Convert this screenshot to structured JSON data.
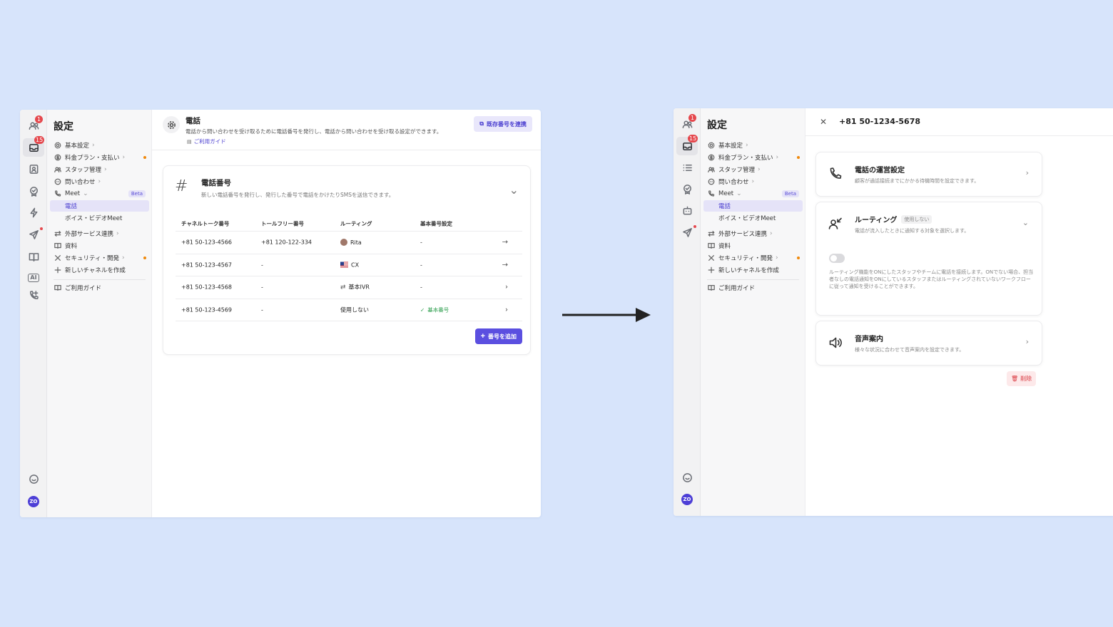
{
  "left_window": {
    "rail": {
      "team_badge": "1",
      "inbox_badge": "15",
      "avatar_text": "ZO",
      "ai_label": "AI"
    },
    "sidebar": {
      "title": "設定",
      "items": [
        {
          "label": "基本設定",
          "icon": "gear-icon"
        },
        {
          "label": "料金プラン・支払い",
          "icon": "dollar-icon"
        },
        {
          "label": "スタッフ管理",
          "icon": "users-icon"
        },
        {
          "label": "問い合わせ",
          "icon": "chat-icon"
        },
        {
          "label": "Meet",
          "icon": "phone-icon",
          "badge": "Beta"
        },
        {
          "label": "電話"
        },
        {
          "label": "ボイス・ビデオMeet"
        },
        {
          "label": "外部サービス連携",
          "icon": "swap-icon"
        },
        {
          "label": "資料",
          "icon": "book-icon"
        },
        {
          "label": "セキュリティ・開発",
          "icon": "tools-icon"
        },
        {
          "label": "新しいチャネルを作成",
          "icon": "plus-icon"
        },
        {
          "label": "ご利用ガイド",
          "icon": "book-icon"
        }
      ]
    },
    "header": {
      "title": "電話",
      "description": "電話から問い合わせを受け取るために電話番号を発行し、電話から問い合わせを受け取る設定ができます。",
      "guide_link": "ご利用ガイド",
      "link_existing_button": "既存番号を連携"
    },
    "card": {
      "title": "電話番号",
      "subtitle": "新しい電話番号を発行し、発行した番号で電話をかけたりSMSを送信できます。",
      "columns": [
        "チャネルトーク番号",
        "トールフリー番号",
        "ルーティング",
        "基本番号設定"
      ],
      "rows": [
        {
          "number": "+81 50-123-4566",
          "tollfree": "+81 120-122-334",
          "routing": "Rita",
          "default": "-"
        },
        {
          "number": "+81 50-123-4567",
          "tollfree": "-",
          "routing": "CX",
          "default": "-"
        },
        {
          "number": "+81 50-123-4568",
          "tollfree": "-",
          "routing": "基本IVR",
          "default": "-"
        },
        {
          "number": "+81 50-123-4569",
          "tollfree": "-",
          "routing": "使用しない",
          "default": "基本番号"
        }
      ],
      "add_button": "番号を追加"
    }
  },
  "right_window": {
    "rail": {
      "team_badge": "1",
      "inbox_badge": "15",
      "avatar_text": "ZO"
    },
    "sidebar": {
      "title": "設定",
      "items": [
        {
          "label": "基本設定"
        },
        {
          "label": "料金プラン・支払い"
        },
        {
          "label": "スタッフ管理"
        },
        {
          "label": "問い合わせ"
        },
        {
          "label": "Meet",
          "badge": "Beta"
        },
        {
          "label": "電話"
        },
        {
          "label": "ボイス・ビデオMeet"
        },
        {
          "label": "外部サービス連携"
        },
        {
          "label": "資料"
        },
        {
          "label": "セキュリティ・開発"
        },
        {
          "label": "新しいチャネルを作成"
        },
        {
          "label": "ご利用ガイド"
        }
      ]
    },
    "panel": {
      "title": "+81 50-1234-5678",
      "operation": {
        "title": "電話の運営設定",
        "description": "顧客が通話接続までにかかる待機時間を設定できます。"
      },
      "routing": {
        "title": "ルーティング",
        "tag": "使用しない",
        "description": "電話が流入したときに通知する対象を選択します。",
        "toggle_on": false,
        "long_text": "ルーティング機能をONにしたスタッフやチームに電話を接続します。ONでない場合、担当者なしの電話通知をONにしているスタッフまたはルーティングされていないワークフローに従って通知を受けることができます。"
      },
      "voice_guide": {
        "title": "音声案内",
        "description": "様々な状況に合わせて音声案内を設定できます。"
      },
      "delete_button": "削除"
    }
  },
  "colors": {
    "background": "#d7e4fb",
    "accent": "#5b4fe0",
    "danger": "#d9363e",
    "success": "#2a9d4b"
  }
}
